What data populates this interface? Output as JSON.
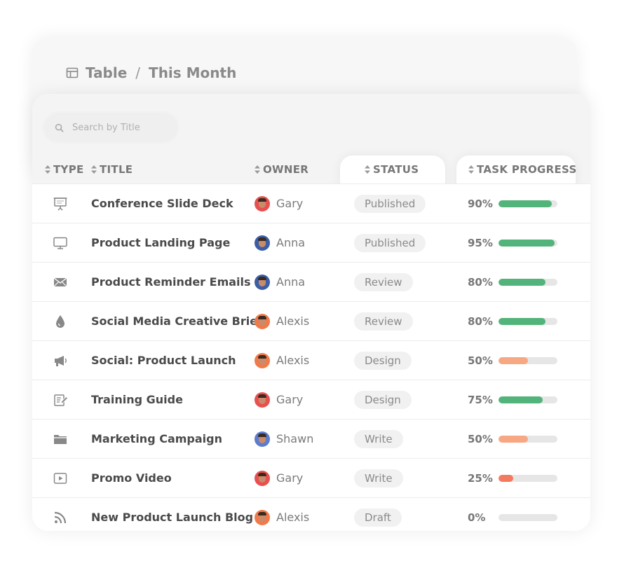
{
  "breadcrumb": {
    "view": "Table",
    "separator": "/",
    "period": "This Month",
    "icon": "table-icon"
  },
  "search": {
    "placeholder": "Search by Title",
    "icon": "search-icon"
  },
  "columns": {
    "type": "TYPE",
    "title": "TITLE",
    "owner": "OWNER",
    "status": "STATUS",
    "progress": "TASK PROGRESS"
  },
  "colors": {
    "progress_high": "#52b47a",
    "progress_mid": "#f7a882",
    "progress_low": "#f47a5f",
    "track": "#e6e6e6"
  },
  "rows": [
    {
      "type_icon": "presentation-icon",
      "title": "Conference Slide Deck",
      "owner": "Gary",
      "avatar_color": "#e8504f",
      "status": "Published",
      "progress_label": "90%",
      "progress": 90,
      "bar_color": "#52b47a"
    },
    {
      "type_icon": "monitor-icon",
      "title": "Product Landing Page",
      "owner": "Anna",
      "avatar_color": "#3b5fa6",
      "status": "Published",
      "progress_label": "95%",
      "progress": 95,
      "bar_color": "#52b47a"
    },
    {
      "type_icon": "envelope-icon",
      "title": "Product Reminder Emails",
      "owner": "Anna",
      "avatar_color": "#3b5fa6",
      "status": "Review",
      "progress_label": "80%",
      "progress": 80,
      "bar_color": "#52b47a"
    },
    {
      "type_icon": "droplet-icon",
      "title": "Social Media Creative Brief",
      "owner": "Alexis",
      "avatar_color": "#f07a4a",
      "status": "Review",
      "progress_label": "80%",
      "progress": 80,
      "bar_color": "#52b47a"
    },
    {
      "type_icon": "megaphone-icon",
      "title": "Social: Product Launch",
      "owner": "Alexis",
      "avatar_color": "#f07a4a",
      "status": "Design",
      "progress_label": "50%",
      "progress": 50,
      "bar_color": "#f7a882"
    },
    {
      "type_icon": "edit-icon",
      "title": "Training Guide",
      "owner": "Gary",
      "avatar_color": "#e8504f",
      "status": "Design",
      "progress_label": "75%",
      "progress": 75,
      "bar_color": "#52b47a"
    },
    {
      "type_icon": "folder-icon",
      "title": "Marketing Campaign",
      "owner": "Shawn",
      "avatar_color": "#5b7ccf",
      "status": "Write",
      "progress_label": "50%",
      "progress": 50,
      "bar_color": "#f7a882"
    },
    {
      "type_icon": "video-icon",
      "title": "Promo Video",
      "owner": "Gary",
      "avatar_color": "#e8504f",
      "status": "Write",
      "progress_label": "25%",
      "progress": 25,
      "bar_color": "#f47a5f"
    },
    {
      "type_icon": "rss-icon",
      "title": "New Product Launch Blog",
      "owner": "Alexis",
      "avatar_color": "#f07a4a",
      "status": "Draft",
      "progress_label": "0%",
      "progress": 0,
      "bar_color": "#52b47a"
    }
  ]
}
